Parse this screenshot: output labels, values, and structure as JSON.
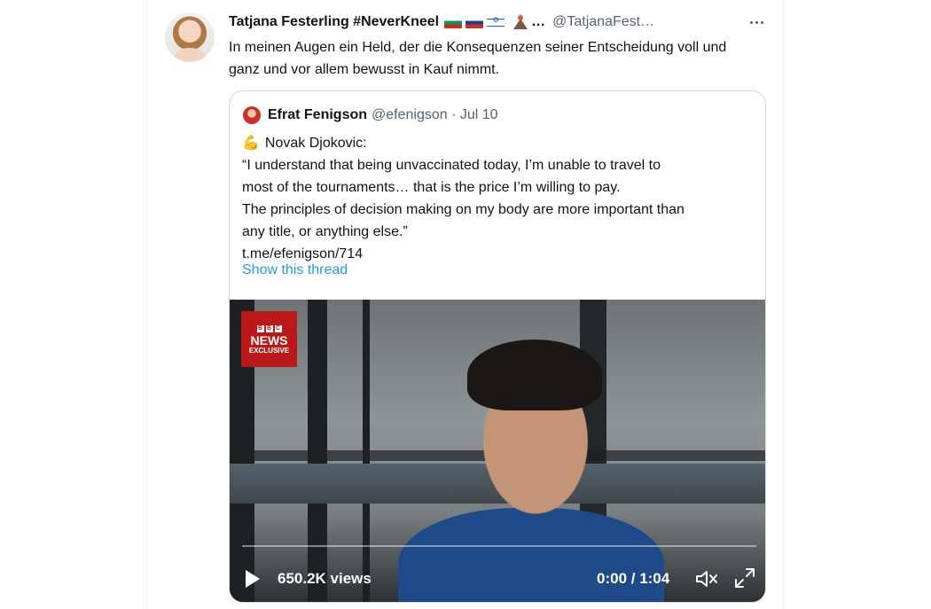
{
  "tweet": {
    "display_name": "Tatjana Festerling #NeverKneel",
    "ellipsis": "…",
    "handle": "@TatjanaFest…",
    "text": "In meinen Augen ein Held, der die Konsequenzen seiner Entscheidung voll und ganz und vor allem bewusst in Kauf nimmt.",
    "flag_icons": [
      "flag-bulgaria-icon",
      "flag-russia-icon",
      "flag-israel-icon",
      "volcano-icon"
    ]
  },
  "quote": {
    "display_name": "Efrat Fenigson",
    "handle_date": "@efenigson · Jul 10",
    "lines": [
      "Novak Djokovic:",
      "“I understand that being unvaccinated today, I’m unable to travel to",
      "most of the tournaments… that is the price I’m willing to pay.",
      "The principles of decision making on my body are more important than",
      "any title, or anything else.”",
      "t.me/efenigson/714"
    ],
    "show_thread": "Show this thread"
  },
  "video": {
    "logo_blocks": [
      "B",
      "B",
      "C"
    ],
    "logo_news": "NEWS",
    "logo_exclusive": "EXCLUSIVE",
    "views": "650.2K views",
    "time": "0:00 / 1:04",
    "progress": 0
  },
  "colors": {
    "accent": "#1d9bf0",
    "text": "#0f1419",
    "secondary": "#536471",
    "bbc_red": "#bb1919"
  }
}
